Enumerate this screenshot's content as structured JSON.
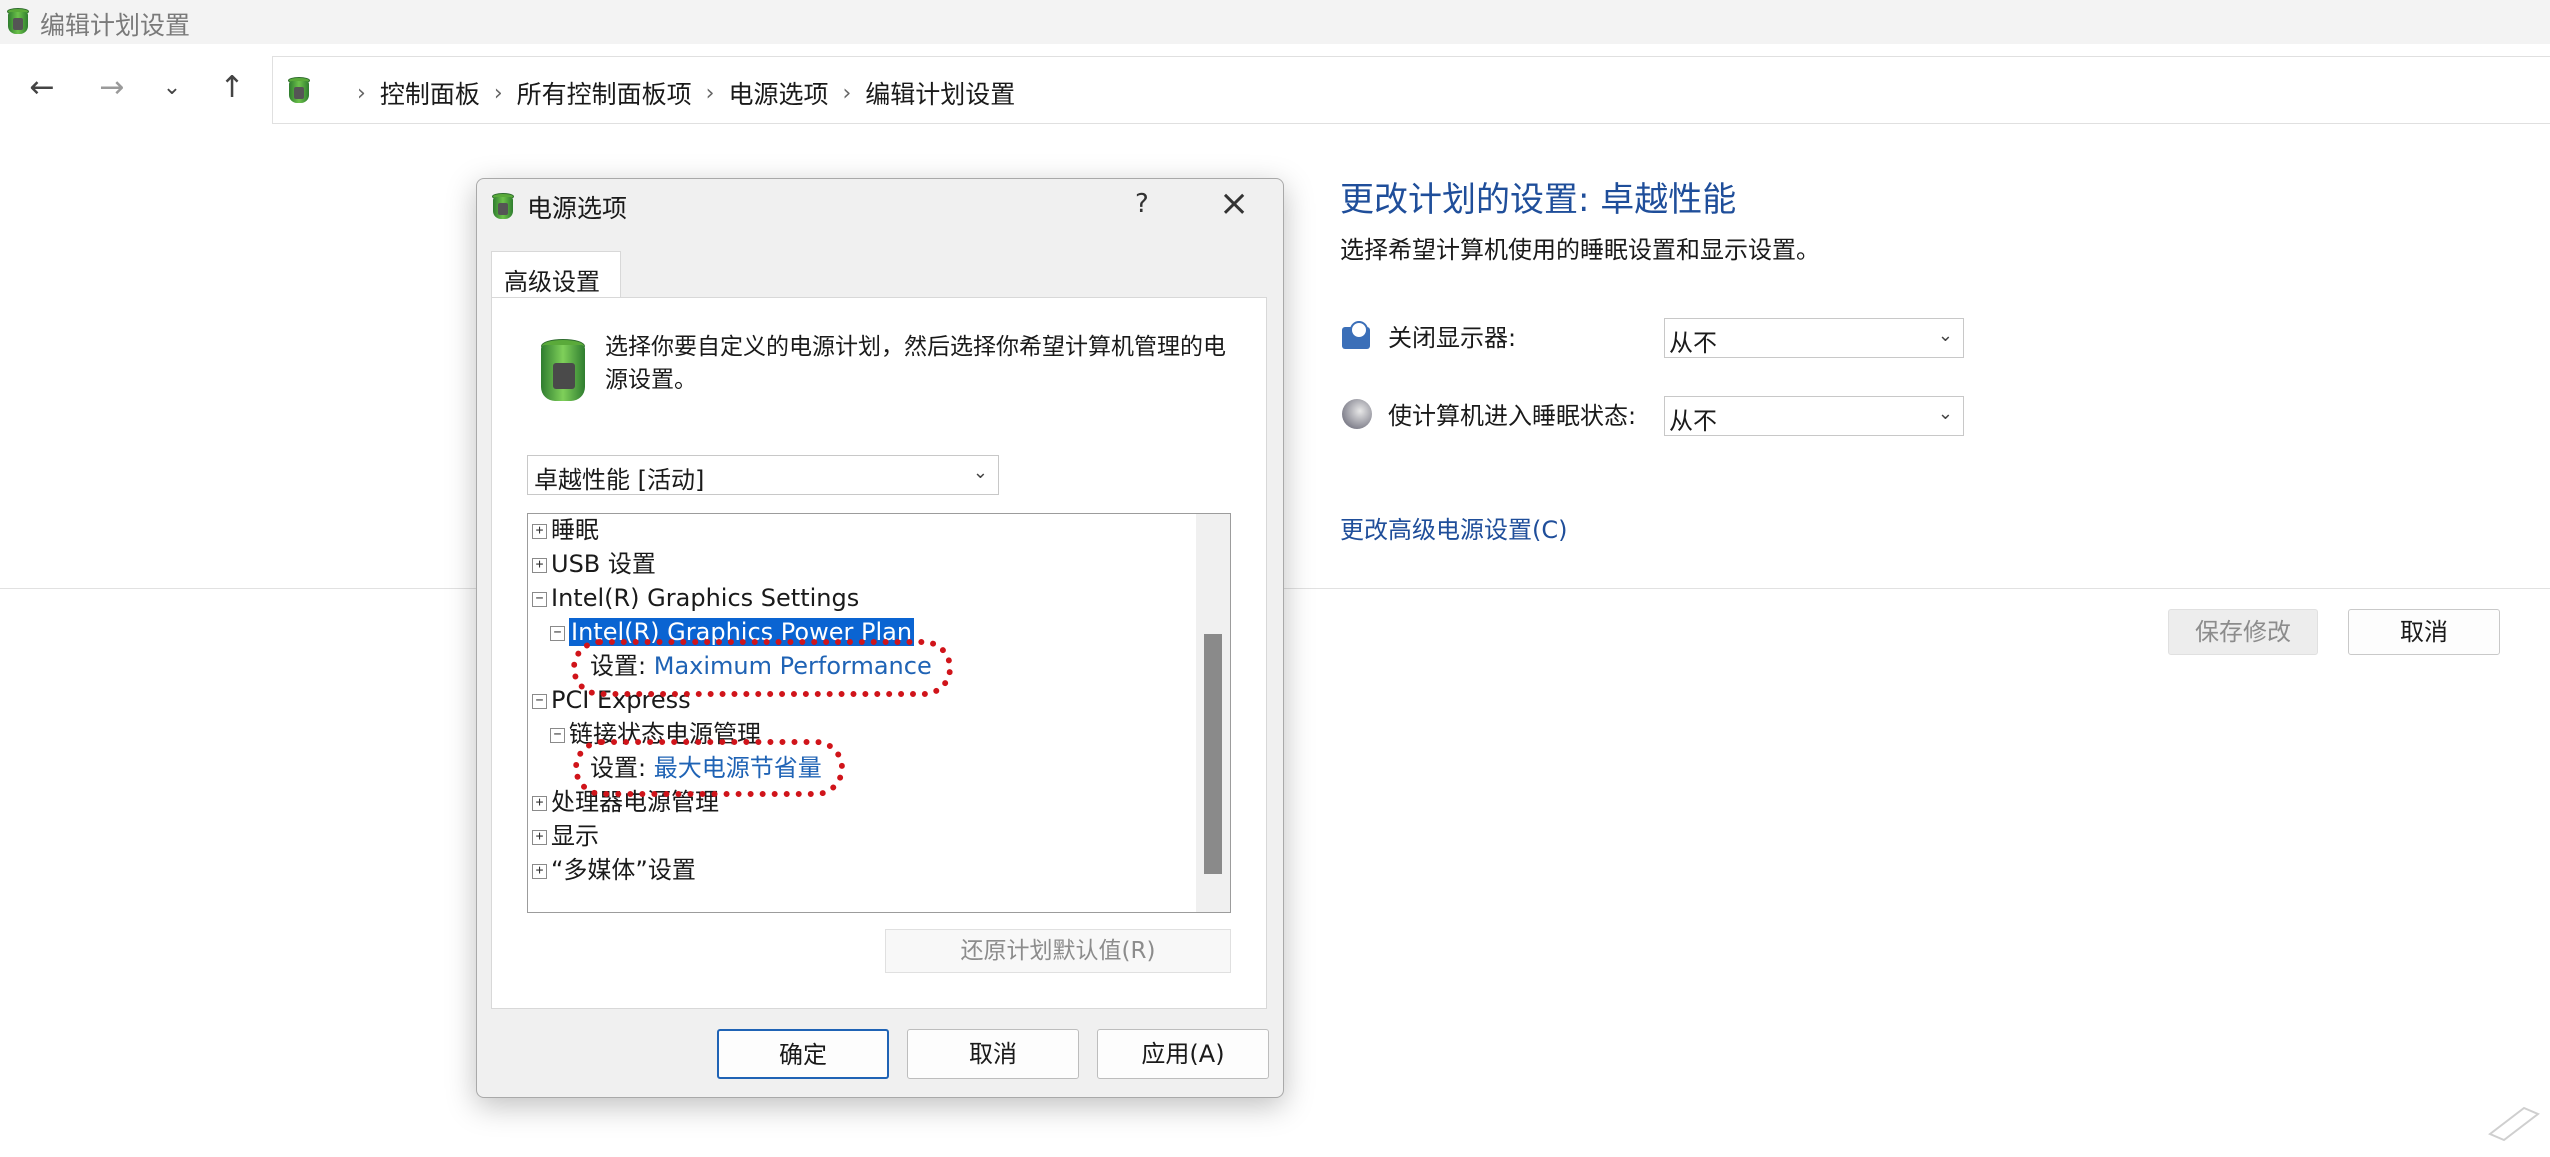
{
  "window": {
    "title": "编辑计划设置"
  },
  "nav": {
    "breadcrumbs": [
      "控制面板",
      "所有控制面板项",
      "电源选项",
      "编辑计划设置"
    ]
  },
  "main": {
    "heading": "更改计划的设置: 卓越性能",
    "subheading": "选择希望计算机使用的睡眠设置和显示设置。",
    "display_off_label": "关闭显示器:",
    "display_off_value": "从不",
    "sleep_label": "使计算机进入睡眠状态:",
    "sleep_value": "从不",
    "advanced_link": "更改高级电源设置(C)",
    "save_label": "保存修改",
    "cancel_label": "取消"
  },
  "dialog": {
    "title": "电源选项",
    "help": "?",
    "tab_label": "高级设置",
    "description": "选择你要自定义的电源计划，然后选择你希望计算机管理的电源设置。",
    "plan_selected": "卓越性能 [活动]",
    "tree": [
      {
        "label": "睡眠",
        "state": "+"
      },
      {
        "label": "USB 设置",
        "state": "+"
      },
      {
        "label": "Intel(R) Graphics Settings",
        "state": "−"
      },
      {
        "label": "Intel(R) Graphics Power Plan",
        "state": "−"
      },
      {
        "setting_label": "设置:",
        "setting_value": "Maximum Performance"
      },
      {
        "label": "PCI Express",
        "state": "−"
      },
      {
        "label": "链接状态电源管理",
        "state": "−"
      },
      {
        "setting_label": "设置:",
        "setting_value": "最大电源节省量"
      },
      {
        "label": "处理器电源管理",
        "state": "+"
      },
      {
        "label": "显示",
        "state": "+"
      },
      {
        "label": "“多媒体”设置",
        "state": "+"
      }
    ],
    "restore_label": "还原计划默认值(R)",
    "ok_label": "确定",
    "cancel_label": "取消",
    "apply_label": "应用(A)"
  },
  "colors": {
    "accent": "#1f63b5",
    "selection": "#0a64d2",
    "annotation": "#d0141a"
  }
}
